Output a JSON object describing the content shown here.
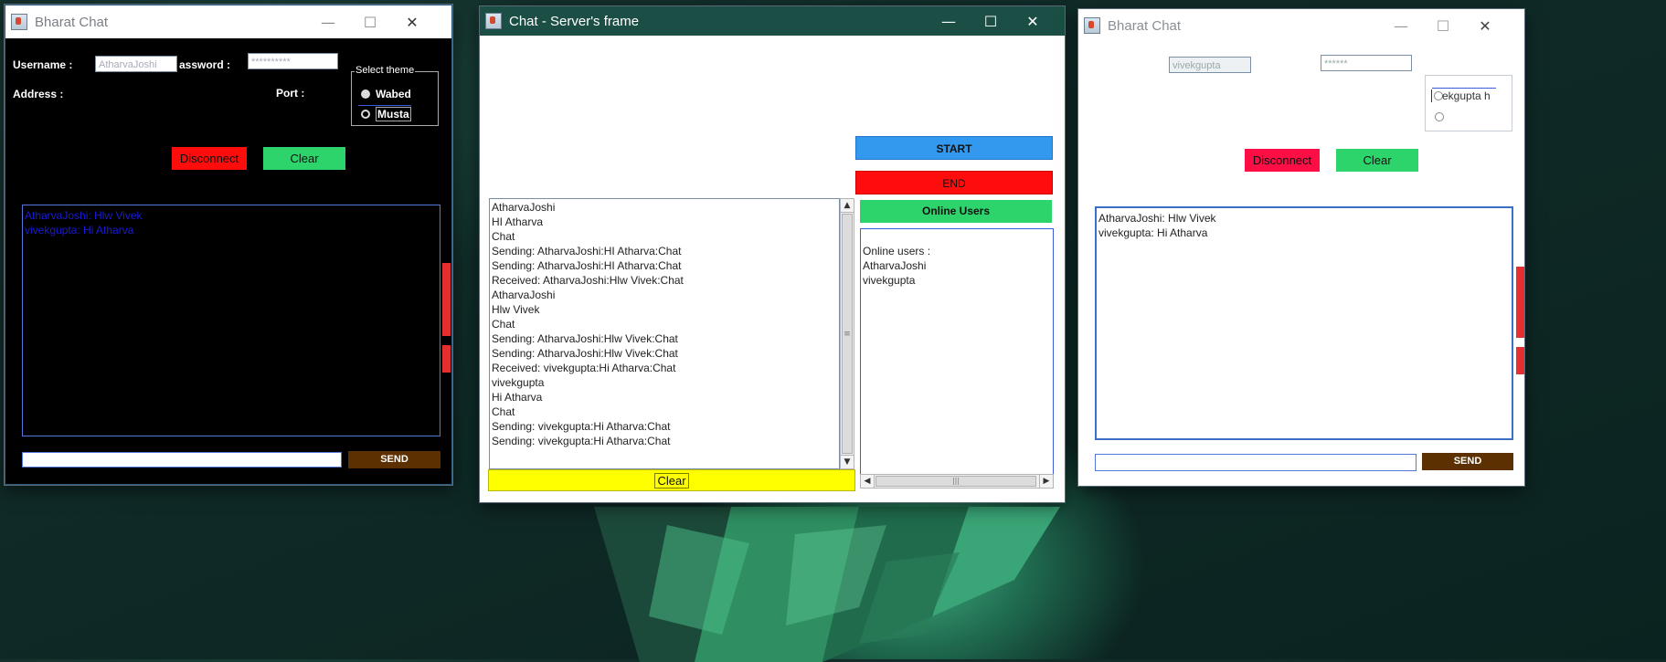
{
  "client_dark": {
    "title": "Bharat Chat",
    "username_label": "Username :",
    "username_value": "AtharvaJoshi",
    "password_label": "assword :",
    "password_value": "**********",
    "address_label": "Address :",
    "port_label": "Port :",
    "theme_group_label": "Select  theme",
    "theme_options": [
      "Wabed",
      "Musta"
    ],
    "disconnect_label": "Disconnect",
    "clear_label": "Clear",
    "messages": [
      "AtharvaJoshi: Hlw Vivek",
      "vivekgupta: Hi Atharva"
    ],
    "send_label": "SEND"
  },
  "server": {
    "title": "Chat - Server's frame",
    "start_label": "START",
    "end_label": "END",
    "online_users_label": "Online Users",
    "log": [
      "AtharvaJoshi",
      "HI Atharva",
      "Chat",
      "Sending: AtharvaJoshi:HI Atharva:Chat",
      "Sending: AtharvaJoshi:HI Atharva:Chat",
      "Received: AtharvaJoshi:Hlw Vivek:Chat",
      "AtharvaJoshi",
      "Hlw Vivek",
      "Chat",
      "Sending: AtharvaJoshi:Hlw Vivek:Chat",
      "Sending: AtharvaJoshi:Hlw Vivek:Chat",
      "Received: vivekgupta:Hi Atharva:Chat",
      "vivekgupta",
      "Hi Atharva",
      "Chat",
      "Sending: vivekgupta:Hi Atharva:Chat",
      "Sending: vivekgupta:Hi Atharva:Chat"
    ],
    "online_users_header": " Online users :",
    "online_users": [
      "AtharvaJoshi",
      "vivekgupta"
    ],
    "clear_label": "Clear"
  },
  "client_light": {
    "title": "Bharat Chat",
    "username_value": "vivekgupta",
    "password_value": "******",
    "theme_overlap_text": "ekgupta h",
    "disconnect_label": "Disconnect",
    "clear_label": "Clear",
    "messages": [
      "AtharvaJoshi: Hlw Vivek",
      "vivekgupta: Hi Atharva"
    ],
    "send_label": "SEND"
  },
  "colors": {
    "red_button": "#ff0d0d",
    "green_button": "#2dd46b",
    "blue_button": "#3399ee",
    "yellow_button": "#ffff00",
    "brown_button": "#5c3000",
    "dark_text": "#1a1ad8"
  }
}
